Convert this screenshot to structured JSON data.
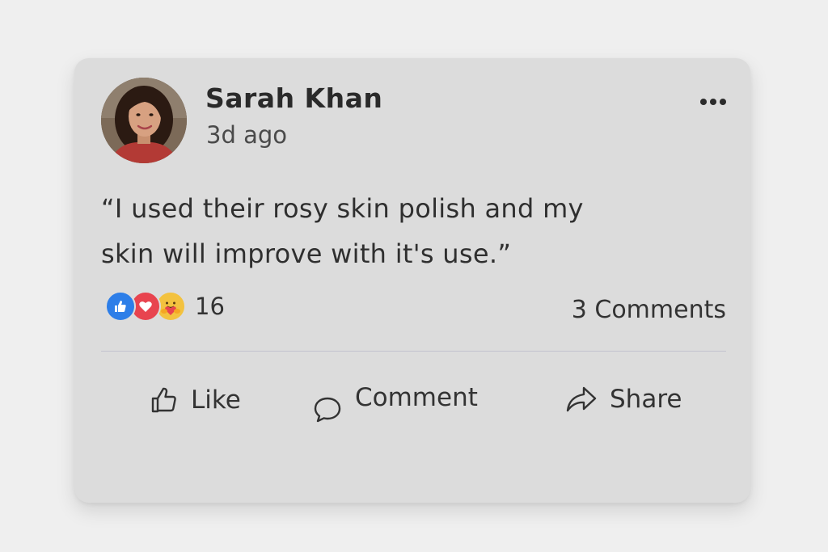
{
  "post": {
    "author_name": "Sarah Khan",
    "time": "3d ago",
    "text": "“I used their rosy skin polish and my skin will improve with it's use.”",
    "more_icon": "more-horizontal-icon",
    "avatar_icon": "profile-photo"
  },
  "reactions": {
    "icons": [
      "like-reaction-icon",
      "love-reaction-icon",
      "care-reaction-icon"
    ],
    "count": "16",
    "comments": "3 Comments"
  },
  "actions": {
    "like_label": "Like",
    "comment_label": "Comment",
    "share_label": "Share"
  },
  "colors": {
    "card_background": "#dcdcdc",
    "page_background": "#efefef",
    "like_blue": "#2d7ee8",
    "love_red": "#e8444f",
    "care_yellow": "#f3c23f"
  }
}
